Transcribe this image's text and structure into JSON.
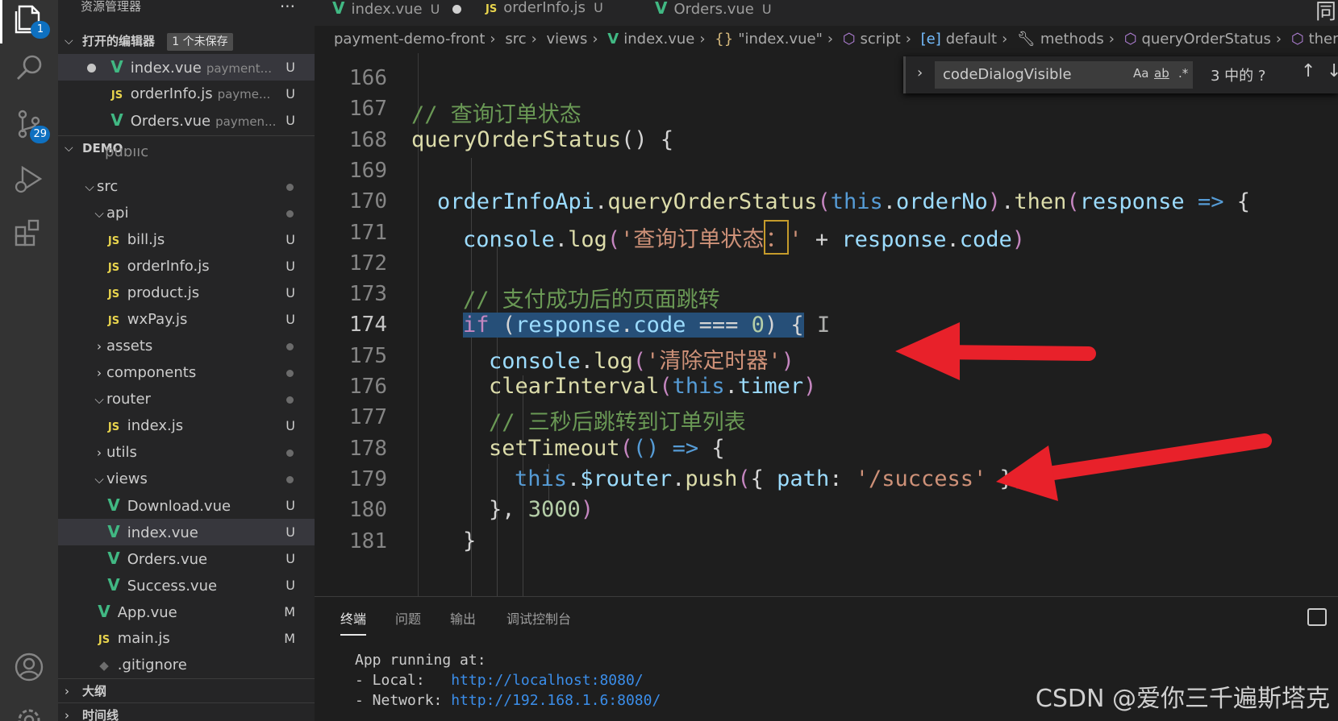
{
  "sidebar": {
    "title": "资源管理器",
    "more": "···",
    "open_editors": {
      "label": "打开的编辑器",
      "unsaved": "1 个未保存",
      "files": [
        {
          "name": "index.vue",
          "desc": "payment...",
          "status": "U"
        },
        {
          "name": "orderInfo.js",
          "desc": "payme...",
          "status": "U"
        },
        {
          "name": "Orders.vue",
          "desc": "paymen...",
          "status": "U"
        }
      ]
    },
    "demo": {
      "label": "DEMO",
      "partial": "public",
      "items": [
        {
          "name": "src"
        },
        {
          "name": "api"
        },
        {
          "name": "bill.js",
          "status": "U"
        },
        {
          "name": "orderInfo.js",
          "status": "U"
        },
        {
          "name": "product.js",
          "status": "U"
        },
        {
          "name": "wxPay.js",
          "status": "U"
        },
        {
          "name": "assets"
        },
        {
          "name": "components"
        },
        {
          "name": "router"
        },
        {
          "name": "index.js",
          "status": "U"
        },
        {
          "name": "utils"
        },
        {
          "name": "views"
        },
        {
          "name": "Download.vue",
          "status": "U"
        },
        {
          "name": "index.vue",
          "status": "U"
        },
        {
          "name": "Orders.vue",
          "status": "U"
        },
        {
          "name": "Success.vue",
          "status": "U"
        },
        {
          "name": "App.vue",
          "status": "M"
        },
        {
          "name": "main.js",
          "status": "M"
        },
        {
          "name": ".gitignore"
        }
      ]
    },
    "outline_label": "大纲",
    "timeline_label": "时间线"
  },
  "activity": {
    "explorer_badge": "1",
    "scm_badge": "29"
  },
  "tabs": [
    {
      "name": "index.vue",
      "status": "U",
      "icon": "vue-icon"
    },
    {
      "name": "orderInfo.js",
      "status": "U",
      "icon": "js-icon"
    },
    {
      "name": "Orders.vue",
      "status": "U",
      "icon": "vue-icon"
    }
  ],
  "tabs_corner": "同",
  "breadcrumb": {
    "root": "payment-demo-front",
    "src": "src",
    "views": "views",
    "file": "index.vue",
    "obj": "\"index.vue\"",
    "script": "script",
    "default": "default",
    "methods": "methods",
    "fn": "queryOrderStatus",
    "then": "then()"
  },
  "find": {
    "query": "codeDialogVisible",
    "opt_case": "Aa",
    "opt_word": "ab",
    "opt_regex": ".*",
    "count": "3 中的 ?"
  },
  "code": {
    "line_numbers": [
      "166",
      "167",
      "168",
      "169",
      "170",
      "171",
      "172",
      "173",
      "174",
      "175",
      "176",
      "177",
      "178",
      "179",
      "180",
      "181"
    ],
    "current_line": "174",
    "l167_comment": "// 查询订单状态",
    "l168_fn": "queryOrderStatus",
    "l170_obj": "orderInfoApi",
    "l170_method": "queryOrderStatus",
    "l170_this": "this",
    "l170_prop": "orderNo",
    "l170_then": "then",
    "l170_param": "response",
    "l171_console": "console",
    "l171_log": "log",
    "l171_str_a": "'查询订单状态",
    "l171_str_b": "：",
    "l171_str_c": "'",
    "l171_resp": "response",
    "l171_code": "code",
    "l173_comment": "// 支付成功后的页面跳转",
    "l174_if": "if",
    "l174_resp": "response",
    "l174_code": "code",
    "l174_num": "0",
    "l175_console": "console",
    "l175_log": "log",
    "l175_str": "'清除定时器'",
    "l176_fn": "clearInterval",
    "l176_this": "this",
    "l176_timer": "timer",
    "l177_comment": "// 三秒后跳转到订单列表",
    "l178_fn": "setTimeout",
    "l179_this": "this",
    "l179_router": "$router",
    "l179_push": "push",
    "l179_path": "path",
    "l179_str": "'/success'",
    "l180_num": "3000"
  },
  "panel": {
    "tabs": [
      "终端",
      "问题",
      "输出",
      "调试控制台"
    ],
    "line1": "App running at:",
    "local_label": "- Local:   ",
    "local_url": "http://localhost:8080/",
    "network_label": "- Network: ",
    "network_url": "http://192.168.1.6:8080/"
  },
  "watermark": "CSDN @爱你三千遍斯塔克",
  "colors": {
    "arrow": "#e8212a",
    "accent": "#0e70c0"
  }
}
